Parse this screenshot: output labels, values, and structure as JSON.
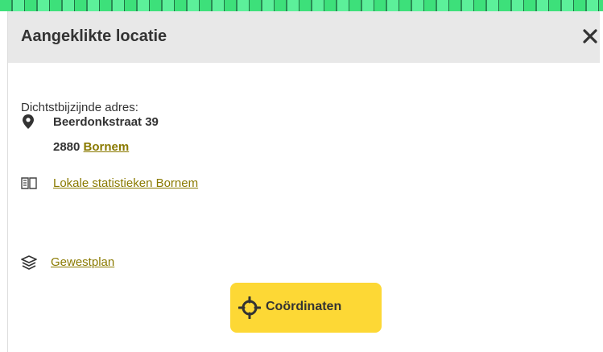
{
  "panel": {
    "title": "Aangeklikte locatie",
    "close_icon": "close-icon"
  },
  "address": {
    "label": "Dichtstbijzijnde adres:",
    "street": "Beerdonkstraat 39",
    "postal_code": "2880",
    "city": "Bornem",
    "icon": "map-pin-icon"
  },
  "links": {
    "statistics": "Lokale statistieken Bornem",
    "statistics_icon": "book-icon",
    "gewestplan": "Gewestplan",
    "gewestplan_icon": "layers-icon"
  },
  "coordinates_button": {
    "label": "Coördinaten",
    "icon": "crosshair-icon",
    "color": "#fdd835"
  },
  "colors": {
    "header_bg": "#e8e8e8",
    "link": "#8a7a00",
    "text": "#333333",
    "map_strip": "#3de07a"
  }
}
